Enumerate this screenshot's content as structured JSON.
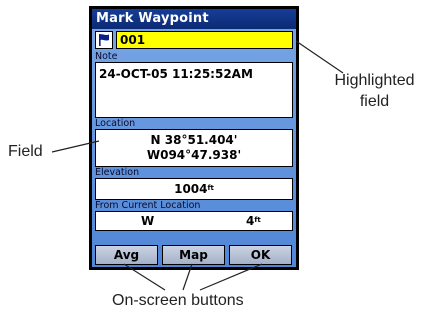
{
  "window": {
    "title": "Mark Waypoint"
  },
  "waypoint": {
    "icon": "flag-icon",
    "name": "001"
  },
  "note": {
    "label": "Note",
    "value": "24-OCT-05 11:25:52AM"
  },
  "location": {
    "label": "Location",
    "lat": "N  38°51.404'",
    "lon": "W094°47.938'"
  },
  "elevation": {
    "label": "Elevation",
    "value": "1004",
    "unit": "ft"
  },
  "from_current": {
    "label": "From Current Location",
    "direction": "W",
    "distance": "4",
    "unit": "ft"
  },
  "buttons": {
    "avg": "Avg",
    "map": "Map",
    "ok": "OK"
  },
  "callouts": {
    "highlighted_line1": "Highlighted",
    "highlighted_line2": "field",
    "field": "Field",
    "buttons": "On-screen buttons"
  },
  "colors": {
    "title_bar": "#163d97",
    "highlight": "#ffff00",
    "screen_bg": "#6a9be0"
  }
}
